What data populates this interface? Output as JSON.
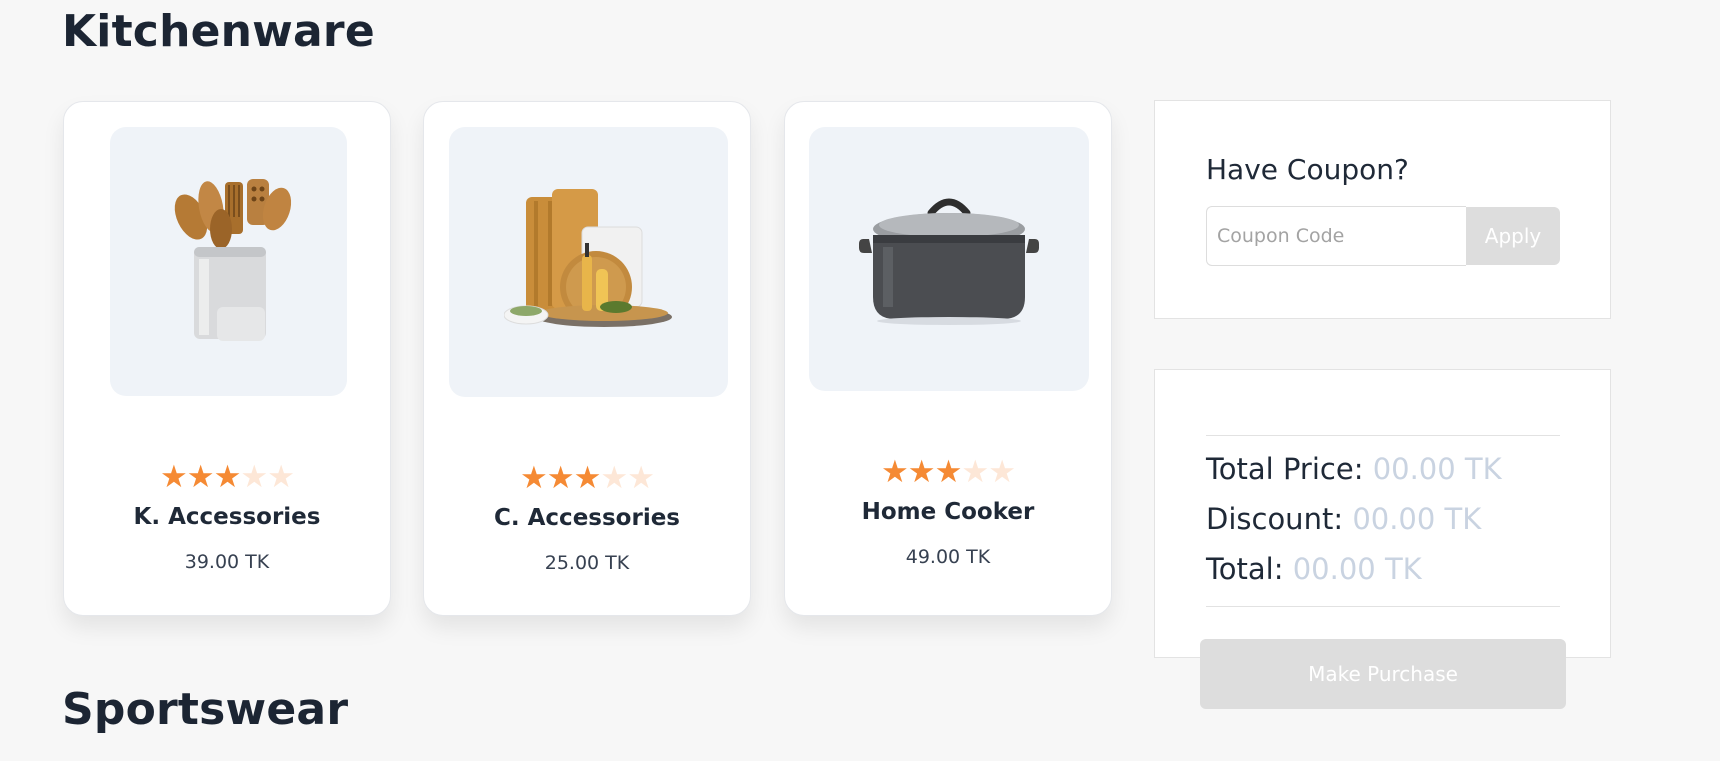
{
  "sections": {
    "kitchen_title": "Kitchenware",
    "sports_title": "Sportswear"
  },
  "products": [
    {
      "name": "K. Accessories",
      "price": "39.00 TK",
      "rating": 3,
      "max_rating": 5,
      "image": "utensil-holder-image"
    },
    {
      "name": "C. Accessories",
      "price": "25.00 TK",
      "rating": 3,
      "max_rating": 5,
      "image": "cutting-boards-image"
    },
    {
      "name": "Home Cooker",
      "price": "49.00 TK",
      "rating": 3,
      "max_rating": 5,
      "image": "cooking-pot-image"
    }
  ],
  "coupon": {
    "title": "Have Coupon?",
    "placeholder": "Coupon Code",
    "apply_label": "Apply"
  },
  "summary": {
    "total_price_label": "Total Price:",
    "total_price_value": "00.00 TK",
    "discount_label": "Discount:",
    "discount_value": "00.00 TK",
    "total_label": "Total:",
    "total_value": "00.00 TK"
  },
  "purchase_label": "Make Purchase",
  "colors": {
    "star_filled": "#f58a34",
    "star_empty": "#fde7d7",
    "muted_value": "#c9d3e1",
    "disabled_button": "#dddddd"
  }
}
